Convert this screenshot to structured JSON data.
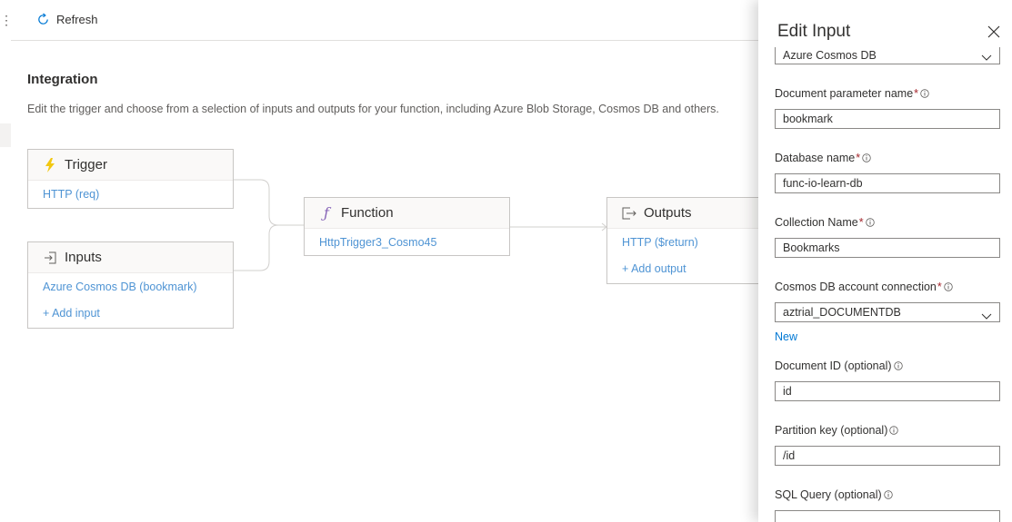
{
  "toolbar": {
    "refresh_label": "Refresh"
  },
  "page": {
    "title": "Integration",
    "description": "Edit the trigger and choose from a selection of inputs and outputs for your function, including Azure Blob Storage, Cosmos DB and others."
  },
  "trigger": {
    "title": "Trigger",
    "link": "HTTP (req)"
  },
  "inputs": {
    "title": "Inputs",
    "link": "Azure Cosmos DB (bookmark)",
    "add_label": "+ Add input"
  },
  "function": {
    "title": "Function",
    "name": "HttpTrigger3_Cosmo45"
  },
  "outputs": {
    "title": "Outputs",
    "link": "HTTP ($return)",
    "add_label": "+ Add output"
  },
  "panel": {
    "title": "Edit Input",
    "binding_type": "Azure Cosmos DB",
    "fields": {
      "doc_param_label": "Document parameter name",
      "doc_param_value": "bookmark",
      "db_name_label": "Database name",
      "db_name_value": "func-io-learn-db",
      "collection_label": "Collection Name",
      "collection_value": "Bookmarks",
      "connection_label": "Cosmos DB account connection",
      "connection_value": "aztrial_DOCUMENTDB",
      "new_link": "New",
      "doc_id_label": "Document ID (optional)",
      "doc_id_value": "id",
      "partition_label": "Partition key (optional)",
      "partition_value": "/id",
      "sql_label": "SQL Query (optional)",
      "sql_value": ""
    },
    "required_mark": "*"
  },
  "colors": {
    "link": "#4f94d4",
    "accent": "#0078d4",
    "required": "#a4262c",
    "trigger_icon": "#f2c811",
    "function_icon": "#8764b8"
  }
}
